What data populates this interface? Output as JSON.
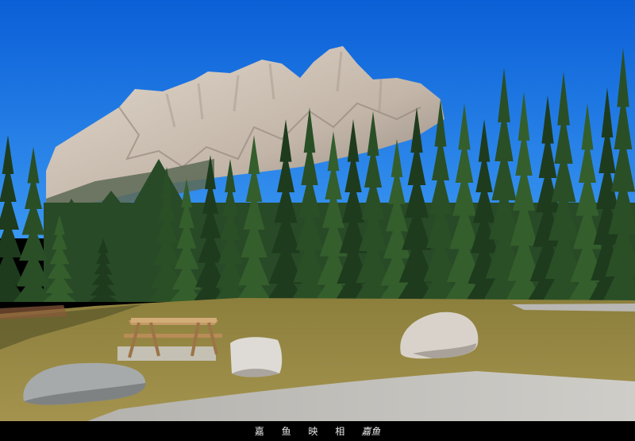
{
  "photo": {
    "caption": "嘉 鱼 映 相",
    "signature": "嘉鱼",
    "colors": {
      "sky_top": "#0a5fd6",
      "sky_bottom": "#2f8ef0",
      "rock_light": "#d9cfc4",
      "rock_dark": "#9c8f84",
      "forest_dark": "#1f3a1f",
      "forest_mid": "#2f5a2a",
      "grass": "#9a8a45",
      "gravel": "#bdbbb6",
      "table_wood": "#b08a5a",
      "boulder": "#c8c4be"
    }
  }
}
